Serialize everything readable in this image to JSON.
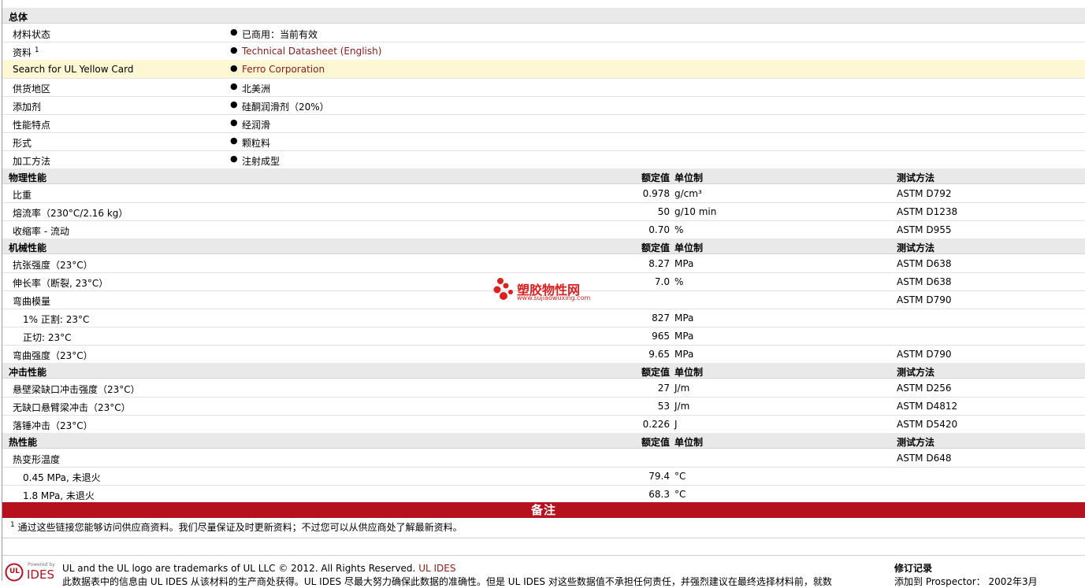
{
  "general": {
    "title": "总体",
    "rows": [
      {
        "label": "材料状态",
        "value": "已商用：当前有效"
      },
      {
        "label": "资料",
        "sup": "1",
        "value": "Technical Datasheet (English)",
        "link": true
      },
      {
        "label": "Search for UL Yellow Card",
        "value": "Ferro Corporation",
        "link": true,
        "highlight": true
      },
      {
        "label": "供货地区",
        "value": "北美洲"
      },
      {
        "label": "添加剂",
        "value": "硅酮润滑剂（20%）"
      },
      {
        "label": "性能特点",
        "value": "经润滑"
      },
      {
        "label": "形式",
        "value": "颗粒料"
      },
      {
        "label": "加工方法",
        "value": "注射成型"
      }
    ]
  },
  "headers": {
    "nominal": "额定值",
    "unit": "单位制",
    "test": "测试方法"
  },
  "sections": [
    {
      "title": "物理性能",
      "rows": [
        {
          "label": "比重",
          "value": "0.978",
          "unit": "g/cm³",
          "test": "ASTM D792"
        },
        {
          "label": "熔流率（230°C/2.16 kg）",
          "value": "50",
          "unit": "g/10 min",
          "test": "ASTM D1238"
        },
        {
          "label": "收缩率 - 流动",
          "value": "0.70",
          "unit": "%",
          "test": "ASTM D955"
        }
      ]
    },
    {
      "title": "机械性能",
      "rows": [
        {
          "label": "抗张强度（23°C）",
          "value": "8.27",
          "unit": "MPa",
          "test": "ASTM D638"
        },
        {
          "label": "伸长率（断裂, 23°C）",
          "value": "7.0",
          "unit": "%",
          "test": "ASTM D638"
        },
        {
          "label": "弯曲模量",
          "value": "",
          "unit": "",
          "test": "ASTM D790"
        },
        {
          "label": "1% 正割: 23°C",
          "value": "827",
          "unit": "MPa",
          "test": "",
          "sub": true
        },
        {
          "label": "正切: 23°C",
          "value": "965",
          "unit": "MPa",
          "test": "",
          "sub": true
        },
        {
          "label": "弯曲强度（23°C）",
          "value": "9.65",
          "unit": "MPa",
          "test": "ASTM D790"
        }
      ]
    },
    {
      "title": "冲击性能",
      "rows": [
        {
          "label": "悬壁梁缺口冲击强度（23°C）",
          "value": "27",
          "unit": "J/m",
          "test": "ASTM D256"
        },
        {
          "label": "无缺口悬臂梁冲击（23°C）",
          "value": "53",
          "unit": "J/m",
          "test": "ASTM D4812"
        },
        {
          "label": "落锤冲击（23°C）",
          "value": "0.226",
          "unit": "J",
          "test": "ASTM D5420"
        }
      ]
    },
    {
      "title": "热性能",
      "rows": [
        {
          "label": "热变形温度",
          "value": "",
          "unit": "",
          "test": "ASTM D648"
        },
        {
          "label": "0.45 MPa, 未退火",
          "value": "79.4",
          "unit": "°C",
          "test": "",
          "sub": true
        },
        {
          "label": "1.8 MPa, 未退火",
          "value": "68.3",
          "unit": "°C",
          "test": "",
          "sub": true
        }
      ]
    }
  ],
  "notes": {
    "title": "备注",
    "footnote_num": "1",
    "footnote": "通过这些链接您能够访问供应商资料。我们尽量保证及时更新资料；不过您可以从供应商处了解最新资料。"
  },
  "watermark": {
    "name": "塑胶物性网",
    "url": "www.sujiaowuxing.com"
  },
  "footer": {
    "logo_top": "Powered by",
    "logo_main": "IDES",
    "logo_ul": "UL",
    "trademark": "UL and the UL logo are trademarks of UL LLC © 2012. All Rights Reserved.",
    "ul_ides_link": "UL IDES",
    "disclaimer": "此数据表中的信息由 UL IDES 从该材料的生产商处获得。UL IDES 尽最大努力确保此数据的准确性。但是 UL IDES 对这些数据值不承担任何责任，并强烈建议在最终选择材料前，就数",
    "revision_title": "修订记录",
    "revision_line": "添加到 Prospector：     2002年3月"
  }
}
